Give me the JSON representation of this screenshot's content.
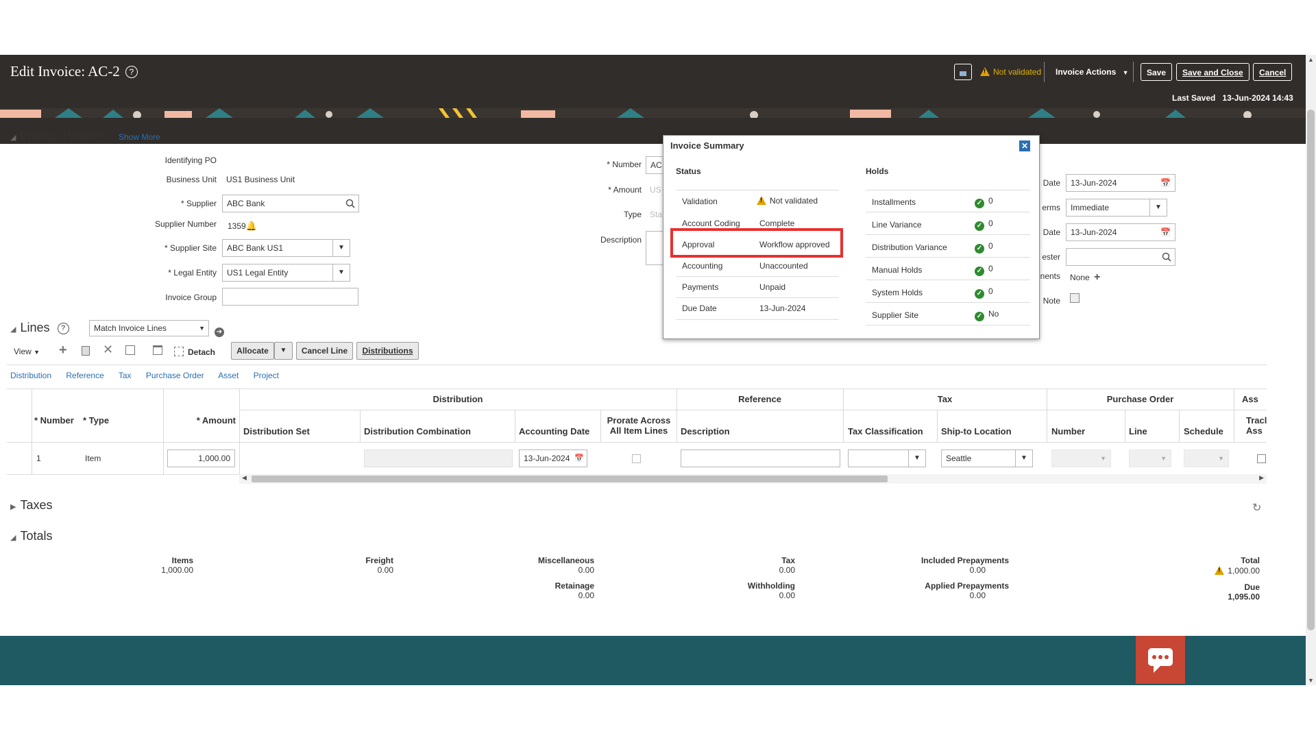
{
  "header": {
    "title": "Edit Invoice: AC-2",
    "status_text": "Not validated",
    "invoice_actions": "Invoice Actions",
    "save": "Save",
    "save_close": "Save and Close",
    "cancel": "Cancel",
    "last_saved_label": "Last Saved",
    "last_saved_value": "13-Jun-2024 14:43"
  },
  "invoice_header": {
    "title": "Invoice Header",
    "show_more": "Show More",
    "identifying_po": "Identifying PO",
    "business_unit_label": "Business Unit",
    "business_unit": "US1 Business Unit",
    "supplier_label": "Supplier",
    "supplier": "ABC Bank",
    "supplier_number_label": "Supplier Number",
    "supplier_number": "1359",
    "supplier_site_label": "Supplier Site",
    "supplier_site": "ABC Bank US1",
    "legal_entity_label": "Legal Entity",
    "legal_entity": "US1 Legal Entity",
    "invoice_group_label": "Invoice Group",
    "number_label": "Number",
    "number_value": "AC",
    "amount_label": "Amount",
    "amount_value": "US",
    "type_label": "Type",
    "type_value": "Sta",
    "description_label": "Description",
    "date_label": "Date",
    "date_value": "13-Jun-2024",
    "terms_label": "erms",
    "terms_value": "Immediate",
    "date2_label": "Date",
    "date2_value": "13-Jun-2024",
    "requester_label": "ester",
    "attachments_label": "nents",
    "attachments_value": "None",
    "note_label": "Note"
  },
  "summary": {
    "title": "Invoice Summary",
    "status_heading": "Status",
    "holds_heading": "Holds",
    "status_rows": [
      {
        "label": "Validation",
        "value": "Not validated"
      },
      {
        "label": "Account Coding",
        "value": "Complete"
      },
      {
        "label": "Approval",
        "value": "Workflow approved"
      },
      {
        "label": "Accounting",
        "value": "Unaccounted"
      },
      {
        "label": "Payments",
        "value": "Unpaid"
      },
      {
        "label": "Due Date",
        "value": "13-Jun-2024"
      }
    ],
    "hold_rows": [
      {
        "label": "Installments",
        "value": "0"
      },
      {
        "label": "Line Variance",
        "value": "0"
      },
      {
        "label": "Distribution Variance",
        "value": "0"
      },
      {
        "label": "Manual Holds",
        "value": "0"
      },
      {
        "label": "System Holds",
        "value": "0"
      },
      {
        "label": "Supplier Site",
        "value": "No"
      }
    ],
    "highlight_color": "#e8302f"
  },
  "lines": {
    "title": "Lines",
    "match_select": "Match Invoice Lines",
    "view": "View",
    "detach": "Detach",
    "allocate": "Allocate",
    "cancel_line": "Cancel Line",
    "distributions": "Distributions",
    "tabs": [
      "Distribution",
      "Reference",
      "Tax",
      "Purchase Order",
      "Asset",
      "Project"
    ],
    "groups": [
      "Distribution",
      "Reference",
      "Tax",
      "Purchase Order",
      "Ass"
    ],
    "columns": {
      "number": "Number",
      "type": "Type",
      "amount": "Amount",
      "distribution_set": "Distribution Set",
      "distribution_combination": "Distribution Combination",
      "accounting_date": "Accounting Date",
      "prorate": "Prorate Across All Item Lines",
      "description": "Description",
      "tax_classification": "Tax Classification",
      "ship_to": "Ship-to Location",
      "po_number": "Number",
      "po_line": "Line",
      "po_schedule": "Schedule",
      "track": "Tracl Ass"
    },
    "row": {
      "number": "1",
      "type": "Item",
      "amount": "1,000.00",
      "accounting_date": "13-Jun-2024",
      "ship_to": "Seattle"
    }
  },
  "taxes": {
    "title": "Taxes"
  },
  "totals": {
    "title": "Totals",
    "items_label": "Items",
    "items": "1,000.00",
    "freight_label": "Freight",
    "freight": "0.00",
    "misc_label": "Miscellaneous",
    "misc": "0.00",
    "retainage_label": "Retainage",
    "retainage": "0.00",
    "tax_label": "Tax",
    "tax": "0.00",
    "withholding_label": "Withholding",
    "withholding": "0.00",
    "incl_prepay_label": "Included Prepayments",
    "incl_prepay": "0.00",
    "appl_prepay_label": "Applied Prepayments",
    "appl_prepay": "0.00",
    "total_label": "Total",
    "total": "1,000.00",
    "due_label": "Due",
    "due": "1,095.00"
  }
}
